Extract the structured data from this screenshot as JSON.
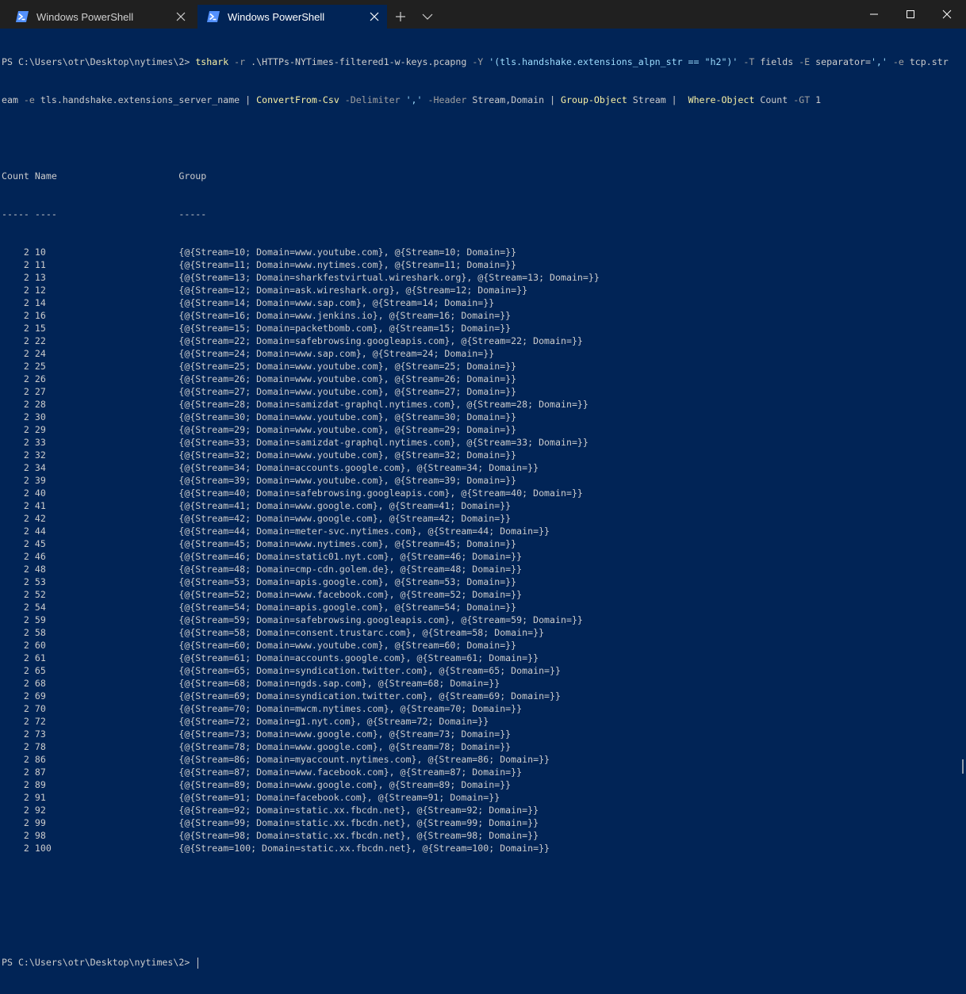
{
  "window": {
    "tabs": [
      {
        "title": "Windows PowerShell",
        "active": false
      },
      {
        "title": "Windows PowerShell",
        "active": true
      }
    ],
    "colors": {
      "background": "#012456",
      "titlebar": "#202020",
      "foreground": "#cccccc",
      "command": "#f9f1a5",
      "parameter": "#a0a0a0",
      "string": "#9cdcfe"
    }
  },
  "icons": {
    "tab_icon": "powershell-icon",
    "close": "close-icon",
    "new_tab": "plus-icon",
    "dropdown": "chevron-down-icon",
    "minimize": "minimize-icon",
    "maximize": "maximize-icon",
    "window_close": "close-icon"
  },
  "terminal": {
    "prompt": "PS C:\\Users\\otr\\Desktop\\nytimes\\2> ",
    "command_line_1": [
      {
        "t": "tshark",
        "c": "cmd"
      },
      {
        "t": " -r ",
        "c": "param"
      },
      {
        "t": ".\\HTTPs-NYTimes-filtered1-w-keys.pcapng ",
        "c": "op"
      },
      {
        "t": "-Y ",
        "c": "param"
      },
      {
        "t": "'(tls.handshake.extensions_alpn_str == \"h2\")'",
        "c": "str"
      },
      {
        "t": " -T ",
        "c": "param"
      },
      {
        "t": "fields ",
        "c": "op"
      },
      {
        "t": "-E ",
        "c": "param"
      },
      {
        "t": "separator=",
        "c": "op"
      },
      {
        "t": "','",
        "c": "str"
      },
      {
        "t": " -e ",
        "c": "param"
      },
      {
        "t": "tcp.str",
        "c": "op"
      }
    ],
    "command_line_2": [
      {
        "t": "eam ",
        "c": "op"
      },
      {
        "t": "-e ",
        "c": "param"
      },
      {
        "t": "tls.handshake.extensions_server_name | ",
        "c": "op"
      },
      {
        "t": "ConvertFrom-Csv",
        "c": "cmd"
      },
      {
        "t": " -Delimiter ",
        "c": "param"
      },
      {
        "t": "','",
        "c": "str"
      },
      {
        "t": " -Header ",
        "c": "param"
      },
      {
        "t": "Stream,Domain | ",
        "c": "op"
      },
      {
        "t": "Group-Object",
        "c": "cmd"
      },
      {
        "t": " Stream |  ",
        "c": "op"
      },
      {
        "t": "Where-Object",
        "c": "cmd"
      },
      {
        "t": " Count ",
        "c": "op"
      },
      {
        "t": "-GT ",
        "c": "param"
      },
      {
        "t": "1",
        "c": "op"
      }
    ],
    "output_header": "Count Name                      Group",
    "output_separator": "----- ----                      -----",
    "rows": [
      "    2 10                        {@{Stream=10; Domain=www.youtube.com}, @{Stream=10; Domain=}}",
      "    2 11                        {@{Stream=11; Domain=www.nytimes.com}, @{Stream=11; Domain=}}",
      "    2 13                        {@{Stream=13; Domain=sharkfestvirtual.wireshark.org}, @{Stream=13; Domain=}}",
      "    2 12                        {@{Stream=12; Domain=ask.wireshark.org}, @{Stream=12; Domain=}}",
      "    2 14                        {@{Stream=14; Domain=www.sap.com}, @{Stream=14; Domain=}}",
      "    2 16                        {@{Stream=16; Domain=www.jenkins.io}, @{Stream=16; Domain=}}",
      "    2 15                        {@{Stream=15; Domain=packetbomb.com}, @{Stream=15; Domain=}}",
      "    2 22                        {@{Stream=22; Domain=safebrowsing.googleapis.com}, @{Stream=22; Domain=}}",
      "    2 24                        {@{Stream=24; Domain=www.sap.com}, @{Stream=24; Domain=}}",
      "    2 25                        {@{Stream=25; Domain=www.youtube.com}, @{Stream=25; Domain=}}",
      "    2 26                        {@{Stream=26; Domain=www.youtube.com}, @{Stream=26; Domain=}}",
      "    2 27                        {@{Stream=27; Domain=www.youtube.com}, @{Stream=27; Domain=}}",
      "    2 28                        {@{Stream=28; Domain=samizdat-graphql.nytimes.com}, @{Stream=28; Domain=}}",
      "    2 30                        {@{Stream=30; Domain=www.youtube.com}, @{Stream=30; Domain=}}",
      "    2 29                        {@{Stream=29; Domain=www.youtube.com}, @{Stream=29; Domain=}}",
      "    2 33                        {@{Stream=33; Domain=samizdat-graphql.nytimes.com}, @{Stream=33; Domain=}}",
      "    2 32                        {@{Stream=32; Domain=www.youtube.com}, @{Stream=32; Domain=}}",
      "    2 34                        {@{Stream=34; Domain=accounts.google.com}, @{Stream=34; Domain=}}",
      "    2 39                        {@{Stream=39; Domain=www.youtube.com}, @{Stream=39; Domain=}}",
      "    2 40                        {@{Stream=40; Domain=safebrowsing.googleapis.com}, @{Stream=40; Domain=}}",
      "    2 41                        {@{Stream=41; Domain=www.google.com}, @{Stream=41; Domain=}}",
      "    2 42                        {@{Stream=42; Domain=www.google.com}, @{Stream=42; Domain=}}",
      "    2 44                        {@{Stream=44; Domain=meter-svc.nytimes.com}, @{Stream=44; Domain=}}",
      "    2 45                        {@{Stream=45; Domain=www.nytimes.com}, @{Stream=45; Domain=}}",
      "    2 46                        {@{Stream=46; Domain=static01.nyt.com}, @{Stream=46; Domain=}}",
      "    2 48                        {@{Stream=48; Domain=cmp-cdn.golem.de}, @{Stream=48; Domain=}}",
      "    2 53                        {@{Stream=53; Domain=apis.google.com}, @{Stream=53; Domain=}}",
      "    2 52                        {@{Stream=52; Domain=www.facebook.com}, @{Stream=52; Domain=}}",
      "    2 54                        {@{Stream=54; Domain=apis.google.com}, @{Stream=54; Domain=}}",
      "    2 59                        {@{Stream=59; Domain=safebrowsing.googleapis.com}, @{Stream=59; Domain=}}",
      "    2 58                        {@{Stream=58; Domain=consent.trustarc.com}, @{Stream=58; Domain=}}",
      "    2 60                        {@{Stream=60; Domain=www.youtube.com}, @{Stream=60; Domain=}}",
      "    2 61                        {@{Stream=61; Domain=accounts.google.com}, @{Stream=61; Domain=}}",
      "    2 65                        {@{Stream=65; Domain=syndication.twitter.com}, @{Stream=65; Domain=}}",
      "    2 68                        {@{Stream=68; Domain=ngds.sap.com}, @{Stream=68; Domain=}}",
      "    2 69                        {@{Stream=69; Domain=syndication.twitter.com}, @{Stream=69; Domain=}}",
      "    2 70                        {@{Stream=70; Domain=mwcm.nytimes.com}, @{Stream=70; Domain=}}",
      "    2 72                        {@{Stream=72; Domain=g1.nyt.com}, @{Stream=72; Domain=}}",
      "    2 73                        {@{Stream=73; Domain=www.google.com}, @{Stream=73; Domain=}}",
      "    2 78                        {@{Stream=78; Domain=www.google.com}, @{Stream=78; Domain=}}",
      "    2 86                        {@{Stream=86; Domain=myaccount.nytimes.com}, @{Stream=86; Domain=}}",
      "    2 87                        {@{Stream=87; Domain=www.facebook.com}, @{Stream=87; Domain=}}",
      "    2 89                        {@{Stream=89; Domain=www.google.com}, @{Stream=89; Domain=}}",
      "    2 91                        {@{Stream=91; Domain=facebook.com}, @{Stream=91; Domain=}}",
      "    2 92                        {@{Stream=92; Domain=static.xx.fbcdn.net}, @{Stream=92; Domain=}}",
      "    2 99                        {@{Stream=99; Domain=static.xx.fbcdn.net}, @{Stream=99; Domain=}}",
      "    2 98                        {@{Stream=98; Domain=static.xx.fbcdn.net}, @{Stream=98; Domain=}}",
      "    2 100                       {@{Stream=100; Domain=static.xx.fbcdn.net}, @{Stream=100; Domain=}}"
    ]
  }
}
